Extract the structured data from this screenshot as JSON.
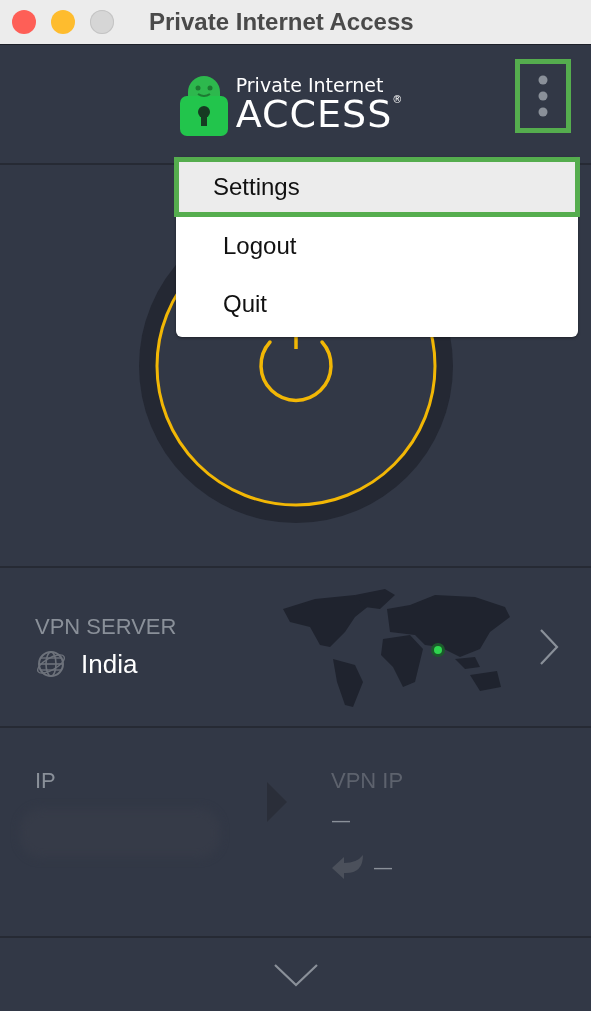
{
  "window": {
    "title": "Private Internet Access"
  },
  "header": {
    "logo_top": "Private Internet",
    "logo_bottom": "ACCESS",
    "registered": "®",
    "menu_button": {
      "highlighted": true
    }
  },
  "menu": [
    {
      "label": "Settings",
      "selected": true,
      "highlighted": true
    },
    {
      "label": "Logout",
      "selected": false,
      "highlighted": false
    },
    {
      "label": "Quit",
      "selected": false,
      "highlighted": false
    }
  ],
  "connect_button": {
    "connected": false
  },
  "vpn_server": {
    "label": "VPN SERVER",
    "name": "India"
  },
  "ip": {
    "label": "IP",
    "value_blurred": true
  },
  "vpn_ip": {
    "label": "VPN IP",
    "value": "—",
    "port_value": "—"
  }
}
